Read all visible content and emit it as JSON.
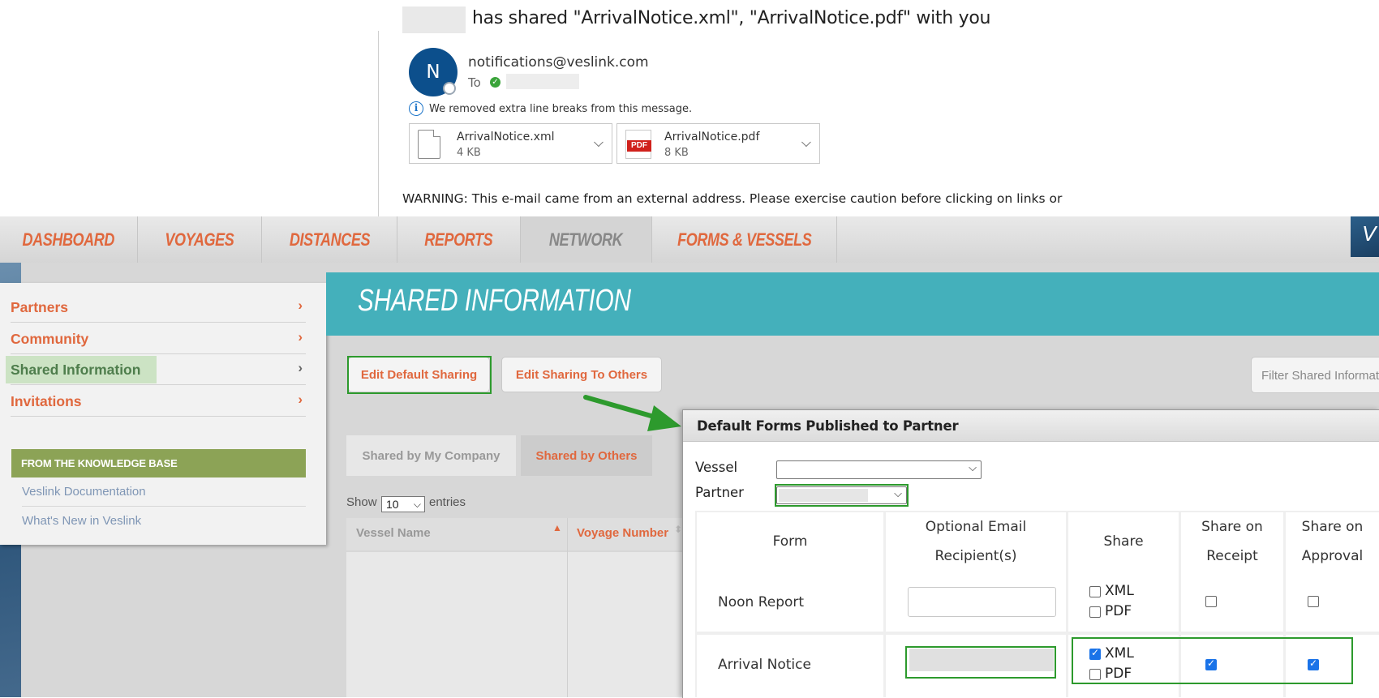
{
  "email": {
    "subject": "has shared \"ArrivalNotice.xml\", \"ArrivalNotice.pdf\" with you",
    "avatar_initial": "N",
    "sender": "notifications@veslink.com",
    "to_label": "To",
    "info_text": "We removed extra line breaks from this message.",
    "attachments": [
      {
        "name": "ArrivalNotice.xml",
        "size": "4 KB",
        "icon": "file-icon"
      },
      {
        "name": "ArrivalNotice.pdf",
        "size": "8 KB",
        "icon": "pdf-icon",
        "badge": "PDF"
      }
    ],
    "warning": "WARNING: This e-mail came from an external address. Please exercise caution before clicking on links or"
  },
  "nav": {
    "items": [
      "DASHBOARD",
      "VOYAGES",
      "DISTANCES",
      "REPORTS",
      "NETWORK",
      "FORMS & VESSELS"
    ],
    "active": "NETWORK",
    "logo_letter": "V"
  },
  "sidebar": {
    "items": [
      {
        "label": "Partners"
      },
      {
        "label": "Community"
      },
      {
        "label": "Shared Information",
        "active": true
      },
      {
        "label": "Invitations"
      }
    ],
    "chevron": "›",
    "kb_header": "FROM THE KNOWLEDGE BASE",
    "kb_links": [
      "Veslink Documentation",
      "What's New in Veslink"
    ]
  },
  "main": {
    "title": "SHARED INFORMATION",
    "buttons": {
      "edit_default": "Edit Default Sharing",
      "edit_others": "Edit Sharing To Others"
    },
    "filter_placeholder": "Filter Shared Informati",
    "tabs": [
      "Shared by My Company",
      "Shared by Others"
    ],
    "show_label": "Show",
    "show_value": "10",
    "entries_label": "entries",
    "columns": [
      "Vessel Name",
      "Voyage Number"
    ]
  },
  "modal": {
    "title": "Default Forms Published to Partner",
    "vessel_label": "Vessel",
    "partner_label": "Partner",
    "headers": {
      "form": "Form",
      "email_1": "Optional Email",
      "email_2": "Recipient(s)",
      "share": "Share",
      "receipt_1": "Share on",
      "receipt_2": "Receipt",
      "approval_1": "Share on",
      "approval_2": "Approval"
    },
    "rows": [
      {
        "form": "Noon Report",
        "xml_label": "XML",
        "pdf_label": "PDF",
        "xml": false,
        "pdf": false,
        "receipt": false,
        "approval": false
      },
      {
        "form": "Arrival Notice",
        "xml_label": "XML",
        "pdf_label": "PDF",
        "xml": true,
        "pdf": false,
        "receipt": true,
        "approval": true
      }
    ]
  },
  "colors": {
    "accent": "#e0683e",
    "banner": "#44b0bb",
    "highlight": "#2d9a2d",
    "kb": "#8ca356"
  }
}
